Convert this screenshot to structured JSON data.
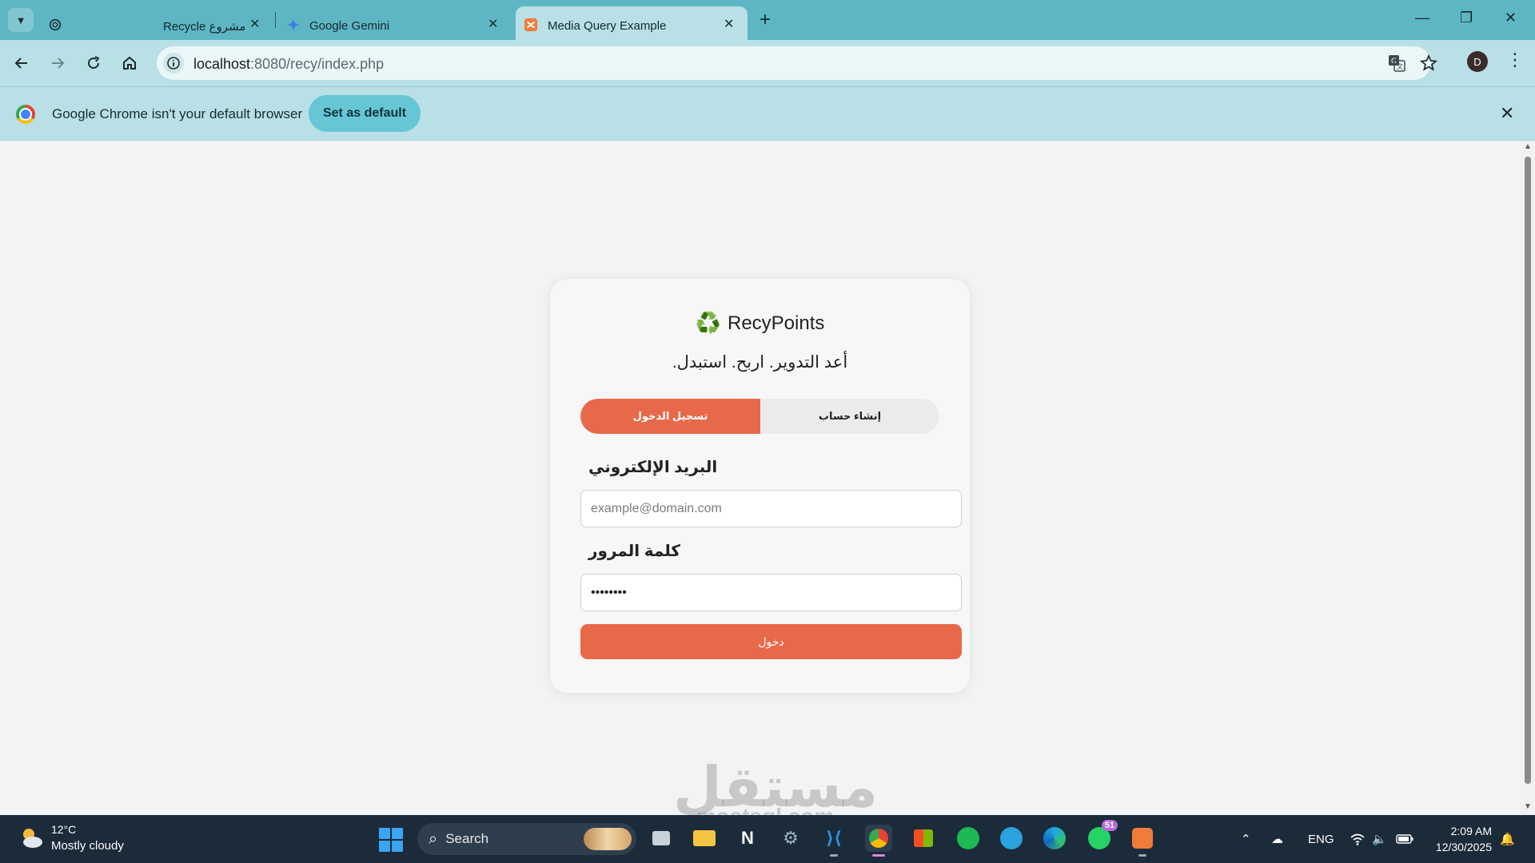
{
  "browser": {
    "tabs": [
      {
        "title": "Recycle مشروع",
        "favicon": "chatgpt-icon"
      },
      {
        "title": "Google Gemini",
        "favicon": "gemini-icon"
      },
      {
        "title": "Media Query Example",
        "favicon": "xampp-icon",
        "active": true
      }
    ],
    "url_host": "localhost",
    "url_rest": ":8080/recy/index.php",
    "profile_initial": "D"
  },
  "infobar": {
    "message": "Google Chrome isn't your default browser",
    "button": "Set as default"
  },
  "app": {
    "brand_icon": "♻️",
    "brand": "RecyPoints",
    "tagline": ".أعد التدوير. اربح. استبدل",
    "tabs": {
      "login": "تسجيل الدخول",
      "register": "إنشاء حساب"
    },
    "email": {
      "label": "البريد الإلكتروني",
      "placeholder": "example@domain.com"
    },
    "password": {
      "label": "كلمة المرور",
      "value": "••••••••"
    },
    "submit": "دخول",
    "accent_color": "#e8694a"
  },
  "watermark": {
    "arabic": "مستقل",
    "latin": "mostaql.com"
  },
  "taskbar": {
    "weather_temp": "12°C",
    "weather_desc": "Mostly cloudy",
    "search_label": "Search",
    "whatsapp_badge": "51",
    "language": "ENG",
    "time": "2:09 AM",
    "date": "12/30/2025"
  }
}
